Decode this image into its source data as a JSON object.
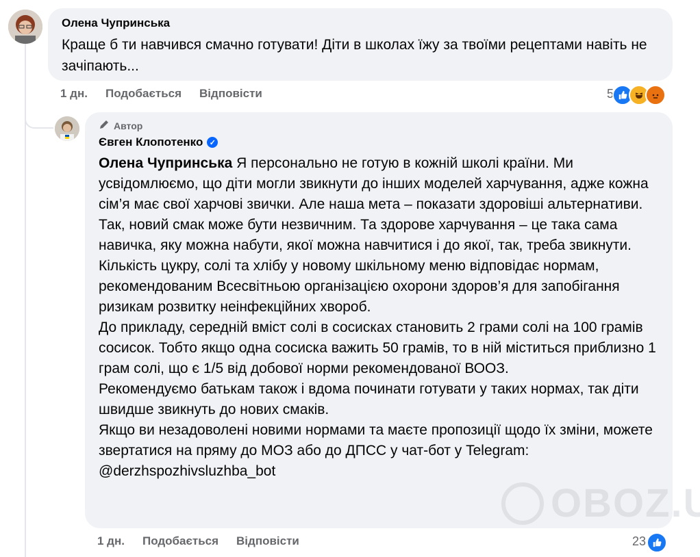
{
  "comment1": {
    "author": "Олена Чупринська",
    "text": "Краще б ти навчився смачно готувати! Діти в школах їжу за твоїми рецептами навіть не зачіпають...",
    "time": "1 дн.",
    "like_label": "Подобається",
    "reply_label": "Відповісти",
    "reactions_count": "5"
  },
  "reply": {
    "author_tag": "Автор",
    "author": "Євген Клопотенко",
    "mention": "Олена Чупринська",
    "text_lines": [
      " Я персонально не готую в кожній школі країни. Ми усвідомлюємо, що діти могли звикнути до інших моделей харчування, адже кожна сім’я має свої харчові звички. Але наша мета – показати здоровіші альтернативи. Так, новий смак може бути незвичним. Та здорове харчування – це така сама навичка, яку можна набути, якої можна навчитися і до якої, так, треба звикнути. Кількість цукру, солі та хлібу у новому шкільному меню відповідає нормам, рекомендованим Всесвітньою організацією охорони здоров’я для запобігання ризикам розвитку неінфекційних хвороб.",
      "До прикладу, середній вміст солі в сосисках становить 2 грами солі на 100 грамів сосисок. Тобто якщо одна сосиска важить 50 грамів, то в ній міститься приблизно 1 грам солі, що є 1/5 від добової норми рекомендованої ВООЗ.",
      "Рекомендуємо батькам також і вдома починати готувати у таких нормах, так діти швидше звикнуть до нових смаків.",
      "Якщо ви незадоволені новими нормами та маєте пропозиції щодо їх зміни, можете звертатися на пряму до МОЗ або до ДПСС у чат-бот у Telegram: @derzhspozhivsluzhba_bot"
    ],
    "time": "1 дн.",
    "like_label": "Подобається",
    "reply_label": "Відповісти",
    "reactions_count": "23"
  },
  "watermark": "OBOZ.UA",
  "icons": {
    "pencil": "pencil-icon",
    "verified": "verified-badge-icon",
    "like": "like-reaction-icon",
    "haha": "haha-reaction-icon",
    "angry": "angry-reaction-icon"
  },
  "colors": {
    "accent": "#0866ff",
    "bubble": "#f0f2f5",
    "meta": "#65676b"
  }
}
